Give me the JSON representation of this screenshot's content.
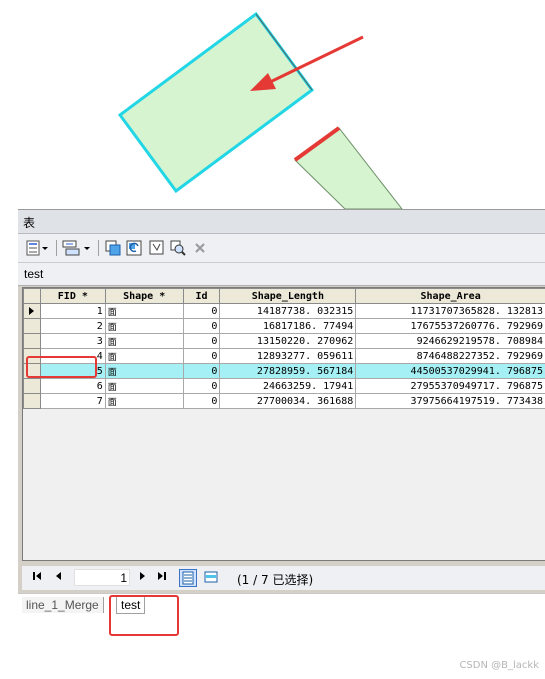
{
  "window": {
    "title": "表"
  },
  "table_name": "test",
  "columns": [
    "FID *",
    "Shape *",
    "Id",
    "Shape_Length",
    "Shape_Area"
  ],
  "rows": [
    {
      "fid": "1",
      "shape": "面",
      "id": "0",
      "length": "14187738. 032315",
      "area": "11731707365828. 132813",
      "current": true
    },
    {
      "fid": "2",
      "shape": "面",
      "id": "0",
      "length": "16817186. 77494",
      "area": "17675537260776. 792969"
    },
    {
      "fid": "3",
      "shape": "面",
      "id": "0",
      "length": "13150220. 270962",
      "area": "9246629219578. 708984"
    },
    {
      "fid": "4",
      "shape": "面",
      "id": "0",
      "length": "12893277. 059611",
      "area": "8746488227352. 792969"
    },
    {
      "fid": "5",
      "shape": "面",
      "id": "0",
      "length": "27828959. 567184",
      "area": "44500537029941. 796875",
      "selected": true
    },
    {
      "fid": "6",
      "shape": "面",
      "id": "0",
      "length": "24663259. 17941",
      "area": "27955370949717. 796875"
    },
    {
      "fid": "7",
      "shape": "面",
      "id": "0",
      "length": "27700034. 361688",
      "area": "37975664197519. 773438"
    }
  ],
  "navigation": {
    "record_value": "1",
    "status": "(1 / 7 已选择)",
    "first_icon": "first-record-icon",
    "prev_icon": "previous-record-icon",
    "next_icon": "next-record-icon",
    "last_icon": "last-record-icon"
  },
  "tabs": [
    {
      "label": "line_1_Merge",
      "active": false
    },
    {
      "label": "test",
      "active": true
    }
  ],
  "toolbar_icons": [
    "table-options-icon",
    "related-tables-icon",
    "select-by-attributes-icon",
    "switch-selection-icon",
    "clear-selection-icon",
    "zoom-to-selected-icon",
    "delete-selected-icon"
  ],
  "colors": {
    "polygon_fill": "#d5f4cf",
    "selection_outline": "#22d6e6",
    "highlight_red": "#e53935",
    "selected_row": "#a4f0f4"
  },
  "watermark": "CSDN @B_lackk"
}
